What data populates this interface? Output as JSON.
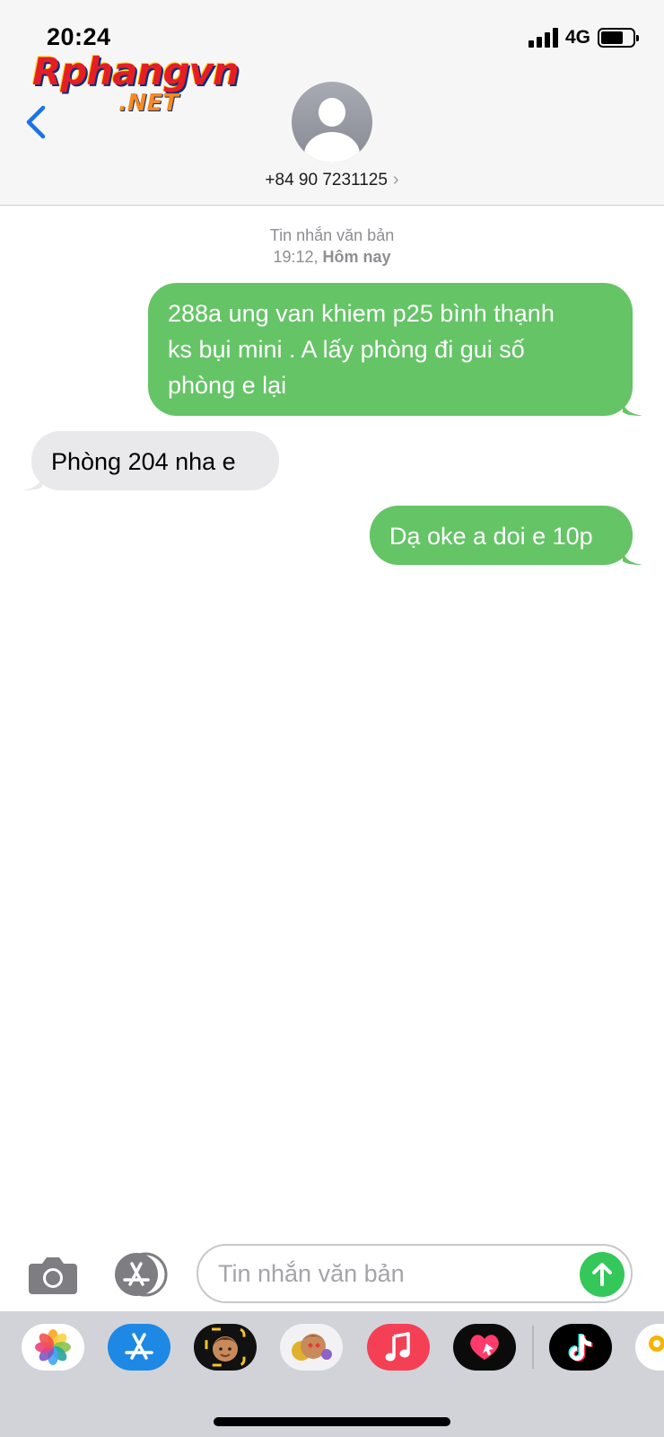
{
  "status": {
    "time": "20:24",
    "network": "4G",
    "signal_bars": 4,
    "battery_level": 0.7
  },
  "watermark": {
    "logo_text": "Rphangvn",
    "logo_suffix": ".NET"
  },
  "header": {
    "back_icon": "chevron-left-icon",
    "contact_number": "+84 90 7231125",
    "contact_chevron": "›"
  },
  "conversation": {
    "service_label": "Tin nhắn văn bản",
    "timestamp_time": "19:12,",
    "timestamp_day": "Hôm nay",
    "messages": [
      {
        "direction": "outgoing",
        "lines": [
          "288a ung van khiem p25 bình thạnh",
          "ks bụi mini . A lấy phòng đi gui số",
          "phòng e lại"
        ]
      },
      {
        "direction": "incoming",
        "lines": [
          "Phòng 204 nha e"
        ]
      },
      {
        "direction": "outgoing",
        "lines": [
          "Dạ oke a doi e 10p"
        ]
      }
    ]
  },
  "composer": {
    "placeholder": "Tin nhắn văn bản",
    "value": ""
  },
  "app_drawer": {
    "apps": [
      "photos-app",
      "app-store-app",
      "memoji-app",
      "animoji-stickers-app",
      "music-app",
      "digital-touch-app",
      "tiktok-app",
      "partial-app"
    ]
  },
  "colors": {
    "outgoing_bubble": "#65c466",
    "incoming_bubble": "#e9e9eb",
    "accent_blue": "#1a73e8",
    "send_button": "#34c759"
  }
}
